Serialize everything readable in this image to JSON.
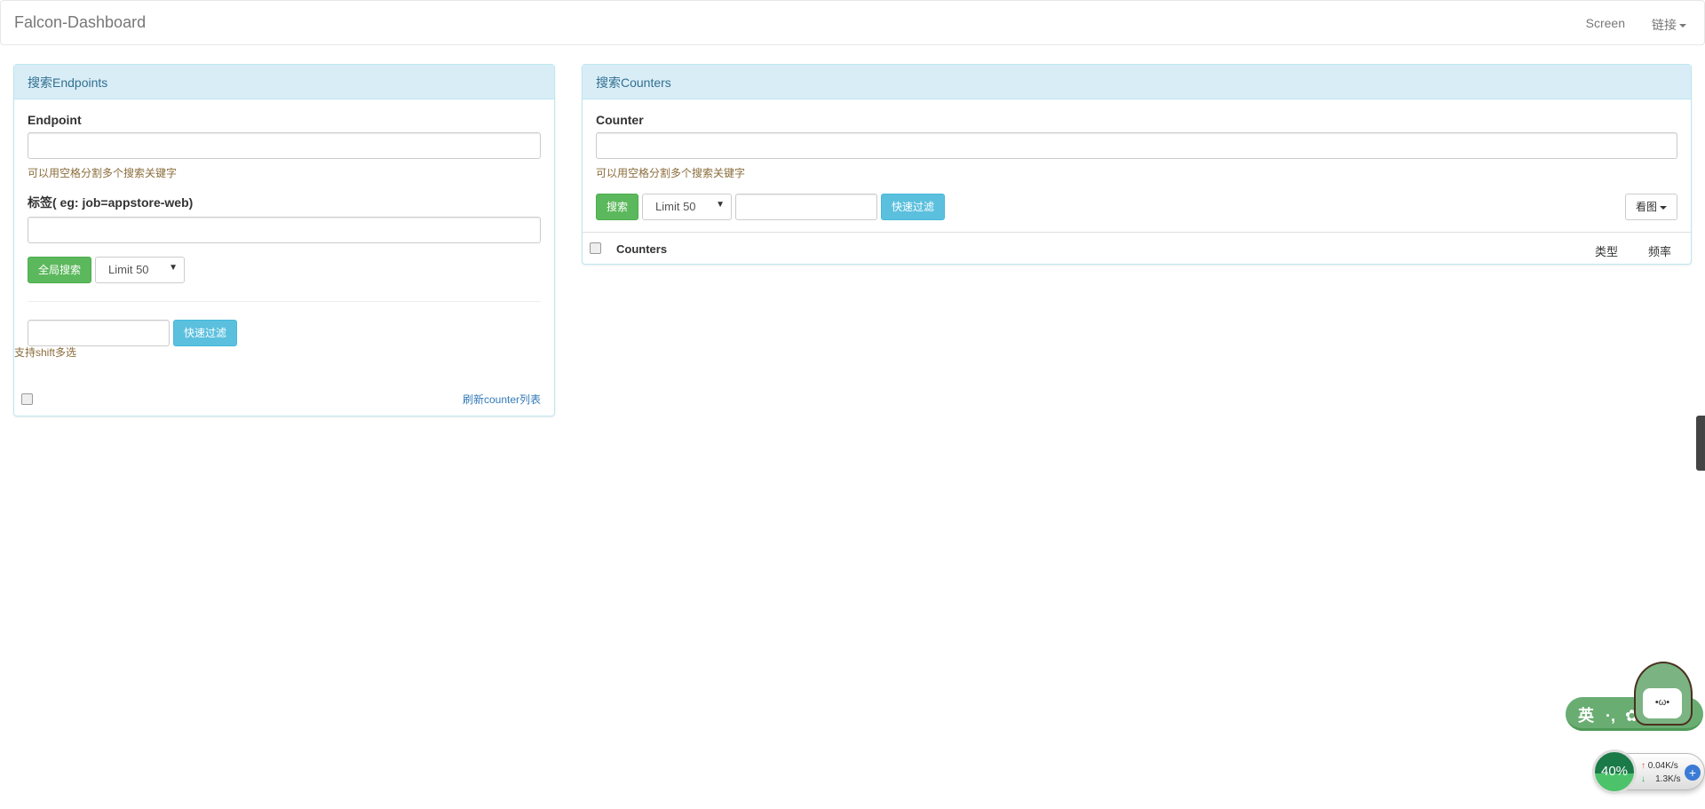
{
  "navbar": {
    "brand": "Falcon-Dashboard",
    "links": [
      "Screen",
      "链接"
    ]
  },
  "endpoints": {
    "title": "搜索Endpoints",
    "endpoint_label": "Endpoint",
    "endpoint_value": "",
    "help": "可以用空格分割多个搜索关键字",
    "tag_label": "标签( eg: job=appstore-web)",
    "tag_value": "",
    "search_button": "全局搜索",
    "limit": "Limit 50",
    "filter_value": "",
    "filter_button": "快速过滤",
    "shift_hint": "支持shift多选",
    "refresh_link": "刷新counter列表"
  },
  "counters": {
    "title": "搜索Counters",
    "counter_label": "Counter",
    "counter_value": "",
    "help": "可以用空格分割多个搜索关键字",
    "search_button": "搜索",
    "limit": "Limit 50",
    "filter_value": "",
    "filter_button": "快速过滤",
    "view_button": "看图",
    "columns": [
      "Counters",
      "类型",
      "频率"
    ]
  },
  "ime": {
    "lang": "英",
    "punct": "·,"
  },
  "netmon": {
    "percent": "40%",
    "up": "0.04K/s",
    "down": "1.3K/s",
    "colors": {
      "up": "#e74c3c",
      "down": "#27ae60"
    }
  }
}
